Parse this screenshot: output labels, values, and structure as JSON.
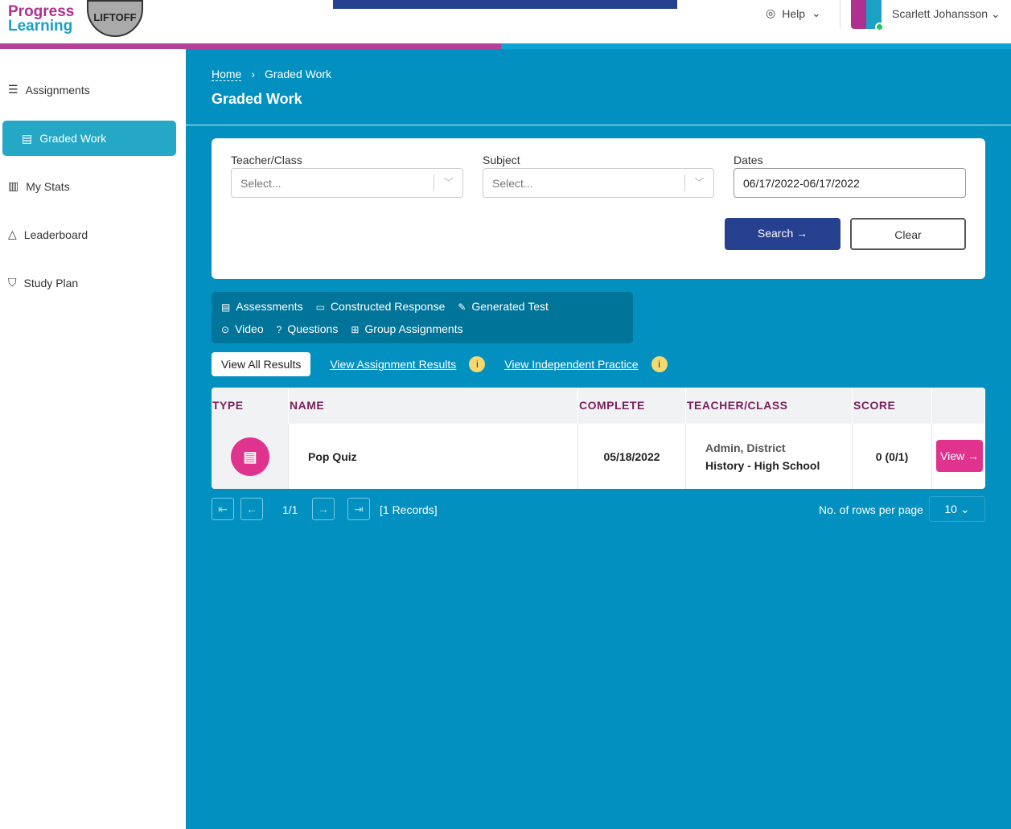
{
  "header": {
    "logo_line1": "Progress",
    "logo_line2": "Learning",
    "badge": "LIFTOFF",
    "help": "Help",
    "user": "Scarlett Johansson"
  },
  "sidebar": {
    "items": [
      {
        "label": "Assignments"
      },
      {
        "label": "Graded Work"
      },
      {
        "label": "My Stats"
      },
      {
        "label": "Leaderboard"
      },
      {
        "label": "Study Plan"
      }
    ]
  },
  "breadcrumb": {
    "home": "Home",
    "current": "Graded Work"
  },
  "page_title": "Graded Work",
  "filters": {
    "teacher_label": "Teacher/Class",
    "teacher_placeholder": "Select...",
    "subject_label": "Subject",
    "subject_placeholder": "Select...",
    "dates_label": "Dates",
    "dates_value": "06/17/2022-06/17/2022",
    "search": "Search",
    "clear": "Clear"
  },
  "legend": [
    "Assessments",
    "Constructed Response",
    "Generated Test",
    "Video",
    "Questions",
    "Group Assignments"
  ],
  "view_tabs": {
    "all": "View All Results",
    "assignment": "View Assignment Results",
    "independent": "View Independent Practice"
  },
  "table": {
    "headers": [
      "TYPE",
      "NAME",
      "COMPLETE",
      "TEACHER/CLASS",
      "SCORE"
    ],
    "rows": [
      {
        "name": "Pop Quiz",
        "complete": "05/18/2022",
        "teacher": "Admin, District",
        "class": "History - High School",
        "score": "0 (0/1)",
        "action": "View"
      }
    ]
  },
  "pagination": {
    "page": "1/1",
    "records": "[1 Records]",
    "rows_label": "No. of rows per page",
    "rows_value": "10"
  }
}
